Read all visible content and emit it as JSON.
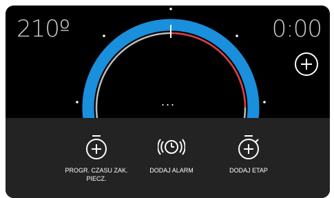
{
  "temperature": "210º",
  "timer": "0:00",
  "more_label": "...",
  "icons": {
    "add": "plus-circle-icon",
    "timer": "stopwatch-plus-icon",
    "alarm": "alarm-ringing-icon",
    "stage": "stopwatch-plus-icon"
  },
  "colors": {
    "ring": "#1a8fdc",
    "progress": "#e0393e",
    "inner_track": "#bdbdbd",
    "panel": "#232323"
  },
  "actions": [
    {
      "label": "PROGR. CZASU ZAK. PIECZ."
    },
    {
      "label": "DODAJ ALARM"
    },
    {
      "label": "DODAJ ETAP"
    }
  ]
}
